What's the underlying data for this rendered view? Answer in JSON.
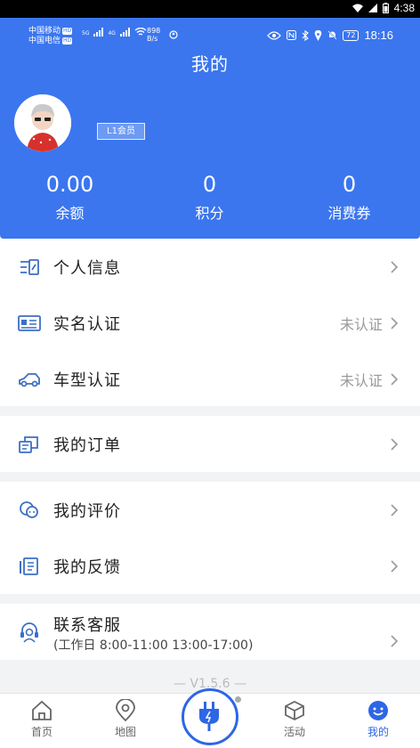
{
  "system_status": {
    "time": "4:38"
  },
  "inner_status": {
    "carrier1": "中国移动",
    "carrier2": "中国电信",
    "hd": "HD",
    "net1": "5G",
    "net2": "4G",
    "speed_value": "898",
    "speed_unit": "B/s",
    "battery": "72",
    "clock": "18:16"
  },
  "header": {
    "title": "我的",
    "member_badge": "L1会员",
    "stats": [
      {
        "value": "0.00",
        "label": "余额"
      },
      {
        "value": "0",
        "label": "积分"
      },
      {
        "value": "0",
        "label": "消费券"
      }
    ]
  },
  "menu": {
    "personal_info": "个人信息",
    "real_name": "实名认证",
    "real_name_status": "未认证",
    "car_model": "车型认证",
    "car_model_status": "未认证",
    "orders": "我的订单",
    "reviews": "我的评价",
    "feedback": "我的反馈",
    "service": "联系客服",
    "service_hours": "(工作日 8:00-11:00 13:00-17:00)"
  },
  "version": "— V1.5.6 —",
  "tabs": [
    {
      "label": "首页",
      "icon": "home-icon"
    },
    {
      "label": "地图",
      "icon": "map-pin-icon"
    },
    {
      "label": "",
      "icon": "plug-icon"
    },
    {
      "label": "活动",
      "icon": "box-icon"
    },
    {
      "label": "我的",
      "icon": "smiley-icon"
    }
  ],
  "colors": {
    "primary": "#3b76ef",
    "active_tab": "#2d66e6",
    "icon_blue": "#3d6fc4"
  }
}
